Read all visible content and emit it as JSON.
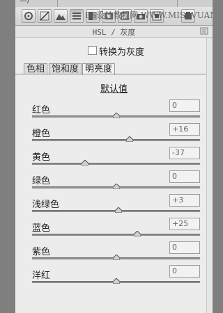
{
  "watermark": "PS设计教程网 WWW.MISSVUAN.NET",
  "top_fragment": "—/",
  "panel": {
    "title_prefix": "HSL / ",
    "title_suffix": "灰度"
  },
  "toolbar": {
    "tools": [
      "basic-icon",
      "tone-curve-icon",
      "detail-icon",
      "hsl-icon",
      "split-toning-icon",
      "lens-icon",
      "effects-icon",
      "camera-calibration-icon",
      "presets-icon",
      "snapshots-icon"
    ]
  },
  "grayscale": {
    "label": "转换为灰度",
    "checked": false
  },
  "tabs": [
    "色相",
    "饱和度",
    "明亮度"
  ],
  "active_tab": "明亮度",
  "default_label": "默认值",
  "sliders": [
    {
      "label": "红色",
      "value": "0",
      "level": 0
    },
    {
      "label": "橙色",
      "value": "+16",
      "level": 16
    },
    {
      "label": "黄色",
      "value": "-37",
      "level": -37
    },
    {
      "label": "绿色",
      "value": "0",
      "level": 0
    },
    {
      "label": "浅绿色",
      "value": "+3",
      "level": 3
    },
    {
      "label": "蓝色",
      "value": "+25",
      "level": 25
    },
    {
      "label": "紫色",
      "value": "0",
      "level": 0
    },
    {
      "label": "洋红",
      "value": "0",
      "level": 0
    }
  ],
  "slider_range": [
    -100,
    100
  ]
}
